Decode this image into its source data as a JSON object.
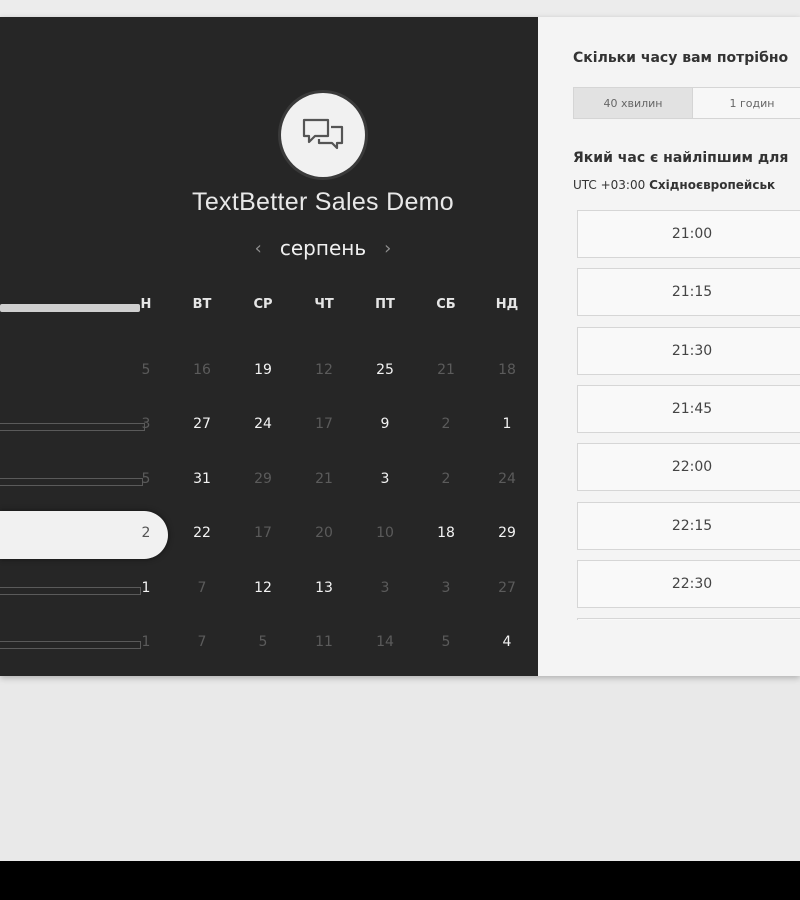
{
  "event": {
    "title": "TextBetter Sales Demo",
    "avatar_icon": "chat-bubbles-icon"
  },
  "calendar": {
    "month": "серпень",
    "prev_icon": "chevron-left-icon",
    "next_icon": "chevron-right-icon",
    "weekdays": [
      "Н",
      "ВТ",
      "СР",
      "ЧТ",
      "ПТ",
      "СБ",
      "НД"
    ],
    "rows": [
      [
        {
          "t": "5",
          "on": false
        },
        {
          "t": "16",
          "on": false
        },
        {
          "t": "19",
          "on": true
        },
        {
          "t": "12",
          "on": false
        },
        {
          "t": "25",
          "on": true
        },
        {
          "t": "21",
          "on": false
        },
        {
          "t": "18",
          "on": false
        }
      ],
      [
        {
          "t": "3",
          "on": false
        },
        {
          "t": "27",
          "on": true
        },
        {
          "t": "24",
          "on": true
        },
        {
          "t": "17",
          "on": false
        },
        {
          "t": "9",
          "on": true
        },
        {
          "t": "2",
          "on": false
        },
        {
          "t": "1",
          "on": true
        }
      ],
      [
        {
          "t": "5",
          "on": false
        },
        {
          "t": "31",
          "on": true
        },
        {
          "t": "29",
          "on": false
        },
        {
          "t": "21",
          "on": false
        },
        {
          "t": "3",
          "on": true
        },
        {
          "t": "2",
          "on": false
        },
        {
          "t": "24",
          "on": false
        }
      ],
      [
        {
          "t": "2",
          "on": false
        },
        {
          "t": "22",
          "on": true
        },
        {
          "t": "17",
          "on": false
        },
        {
          "t": "20",
          "on": false
        },
        {
          "t": "10",
          "on": false
        },
        {
          "t": "18",
          "on": true
        },
        {
          "t": "29",
          "on": true
        }
      ],
      [
        {
          "t": "1",
          "on": true
        },
        {
          "t": "7",
          "on": false
        },
        {
          "t": "12",
          "on": true
        },
        {
          "t": "13",
          "on": true
        },
        {
          "t": "3",
          "on": false
        },
        {
          "t": "3",
          "on": false
        },
        {
          "t": "27",
          "on": false
        }
      ],
      [
        {
          "t": "1",
          "on": false
        },
        {
          "t": "7",
          "on": false
        },
        {
          "t": "5",
          "on": false
        },
        {
          "t": "11",
          "on": false
        },
        {
          "t": "14",
          "on": false
        },
        {
          "t": "5",
          "on": false
        },
        {
          "t": "4",
          "on": true
        }
      ]
    ]
  },
  "duration": {
    "question": "Скільки часу вам потрібно",
    "options": [
      "40 хвилин",
      "1 годин"
    ],
    "selected": 0
  },
  "timeslots": {
    "question": "Який час є найліпшим для",
    "tz_offset": "UTC +03:00",
    "tz_name": "Східноєвропейськ",
    "slots": [
      "21:00",
      "21:15",
      "21:30",
      "21:45",
      "22:00",
      "22:15",
      "22:30",
      ""
    ]
  }
}
